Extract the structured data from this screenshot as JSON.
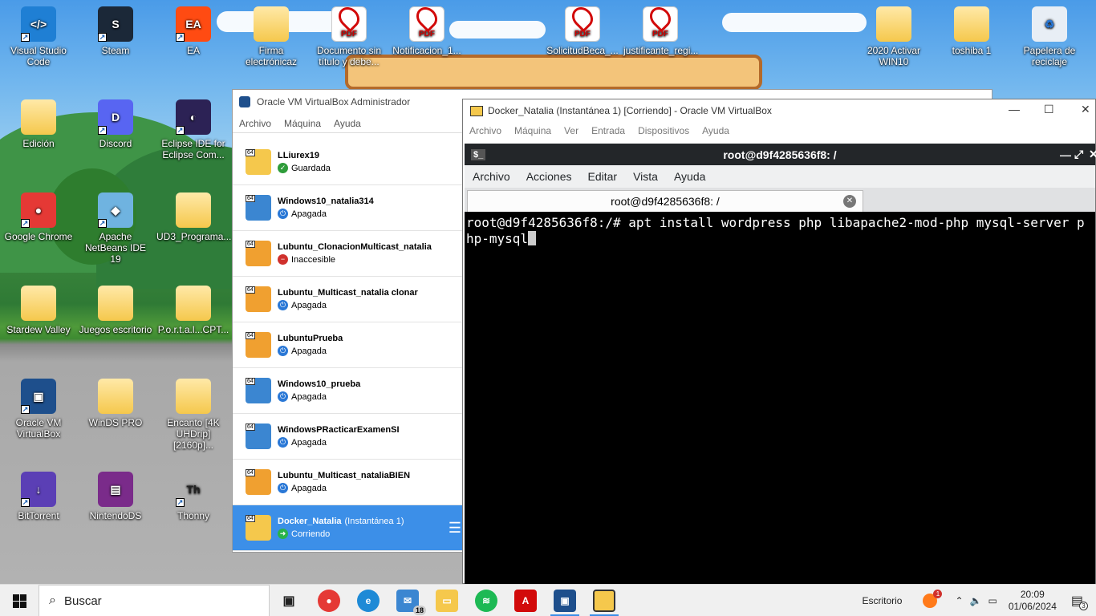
{
  "desktop": {
    "icons": [
      {
        "label": "Visual Studio Code",
        "kind": "vscode",
        "color": "#1f7fd4",
        "glyph": "&lt;/&gt;"
      },
      {
        "label": "Steam",
        "kind": "steam",
        "color": "#1b2838",
        "glyph": "S"
      },
      {
        "label": "EA",
        "kind": "ea",
        "color": "#ff4b12",
        "glyph": "EA"
      },
      {
        "label": "Firma electrónicaz",
        "kind": "folder"
      },
      {
        "label": "Documento sin título y debe...",
        "kind": "pdf"
      },
      {
        "label": "Notificacion_1...",
        "kind": "pdf"
      },
      {
        "label": "SolicitudBeca_...",
        "kind": "pdf"
      },
      {
        "label": "justificante_regi...",
        "kind": "pdf"
      },
      {
        "label": "2020 Activar WIN10",
        "kind": "folder"
      },
      {
        "label": "toshiba 1",
        "kind": "folder"
      },
      {
        "label": "Papelera de reciclaje",
        "kind": "recycle"
      },
      {
        "label": "Edición",
        "kind": "folder"
      },
      {
        "label": "Discord",
        "kind": "discord",
        "color": "#5865f2",
        "glyph": "D"
      },
      {
        "label": "Eclipse IDE for Eclipse Com...",
        "kind": "eclipse",
        "color": "#2c2255",
        "glyph": "◐"
      },
      {
        "label": "Google Chrome",
        "kind": "chrome",
        "color": "#e53935",
        "glyph": "●"
      },
      {
        "label": "Apache NetBeans IDE 19",
        "kind": "netbeans",
        "color": "#6fb3e0",
        "glyph": "◆"
      },
      {
        "label": "UD3_Programa...",
        "kind": "folder"
      },
      {
        "label": "Stardew Valley",
        "kind": "folder"
      },
      {
        "label": "Juegos escritorio",
        "kind": "folder"
      },
      {
        "label": "P.o.r.t.a.l...CPT...",
        "kind": "folder"
      },
      {
        "label": "Oracle VM VirtualBox",
        "kind": "vbox",
        "color": "#1e4f8c",
        "glyph": "▣"
      },
      {
        "label": "WinDS PRO",
        "kind": "folder"
      },
      {
        "label": "Encanto [4K UHDrip][2160p]...",
        "kind": "folder"
      },
      {
        "label": "BitTorrent",
        "kind": "bittorrent",
        "color": "#5b3fb5",
        "glyph": "↓"
      },
      {
        "label": "NintendoDS",
        "kind": "winrar",
        "color": "#7a2b8a",
        "glyph": "▤"
      },
      {
        "label": "Thonny",
        "kind": "thonny",
        "color": "#ffffff",
        "glyph": "Th"
      }
    ]
  },
  "manager": {
    "title": "Oracle VM VirtualBox Administrador",
    "menu": [
      "Archivo",
      "Máquina",
      "Ayuda"
    ],
    "vms": [
      {
        "name": "LLiurex19",
        "state": "Guardada",
        "os": "ubuntu",
        "stateColor": "#2e9c3a",
        "stateGlyph": "✓"
      },
      {
        "name": "Windows10_natalia314",
        "state": "Apagada",
        "os": "win10",
        "stateColor": "#2a78d6",
        "stateGlyph": "⏻"
      },
      {
        "name": "Lubuntu_ClonacionMulticast_natalia",
        "state": "Inaccesible",
        "os": "other",
        "stateColor": "#d0312d",
        "stateGlyph": "−"
      },
      {
        "name": "Lubuntu_Multicast_natalia clonar",
        "state": "Apagada",
        "os": "lubuntu",
        "stateColor": "#2a78d6",
        "stateGlyph": "⏻"
      },
      {
        "name": "LubuntuPrueba",
        "state": "Apagada",
        "os": "lubuntu",
        "stateColor": "#2a78d6",
        "stateGlyph": "⏻"
      },
      {
        "name": "Windows10_prueba",
        "state": "Apagada",
        "os": "win10",
        "stateColor": "#2a78d6",
        "stateGlyph": "⏻"
      },
      {
        "name": "WindowsPRacticarExamenSI",
        "state": "Apagada",
        "os": "win10",
        "stateColor": "#2a78d6",
        "stateGlyph": "⏻"
      },
      {
        "name": "Lubuntu_Multicast_nataliaBIEN",
        "state": "Apagada",
        "os": "lubuntu",
        "stateColor": "#2a78d6",
        "stateGlyph": "⏻"
      },
      {
        "name": "Docker_Natalia",
        "snapshot": "(Instantánea 1)",
        "state": "Corriendo",
        "os": "ubuntu",
        "stateColor": "#29b34a",
        "stateGlyph": "➜",
        "selected": true
      }
    ],
    "badge": "64"
  },
  "vmwindow": {
    "title": "Docker_Natalia (Instantánea 1) [Corriendo] - Oracle VM VirtualBox",
    "menu": [
      "Archivo",
      "Máquina",
      "Ver",
      "Entrada",
      "Dispositivos",
      "Ayuda"
    ],
    "guest": {
      "title": "root@d9f4285636f8: /",
      "menu": [
        "Archivo",
        "Acciones",
        "Editar",
        "Vista",
        "Ayuda"
      ],
      "tab": "root@d9f4285636f8: /",
      "prompt": "root@d9f4285636f8:/# ",
      "command": "apt install wordpress php libapache2-mod-php mysql-server php-mysql"
    }
  },
  "taskbar": {
    "search_placeholder": "Buscar",
    "mail_count": "18",
    "desktop_label": "Escritorio",
    "notif_count": "1",
    "time": "20:09",
    "date": "01/06/2024",
    "action_count": "3"
  }
}
